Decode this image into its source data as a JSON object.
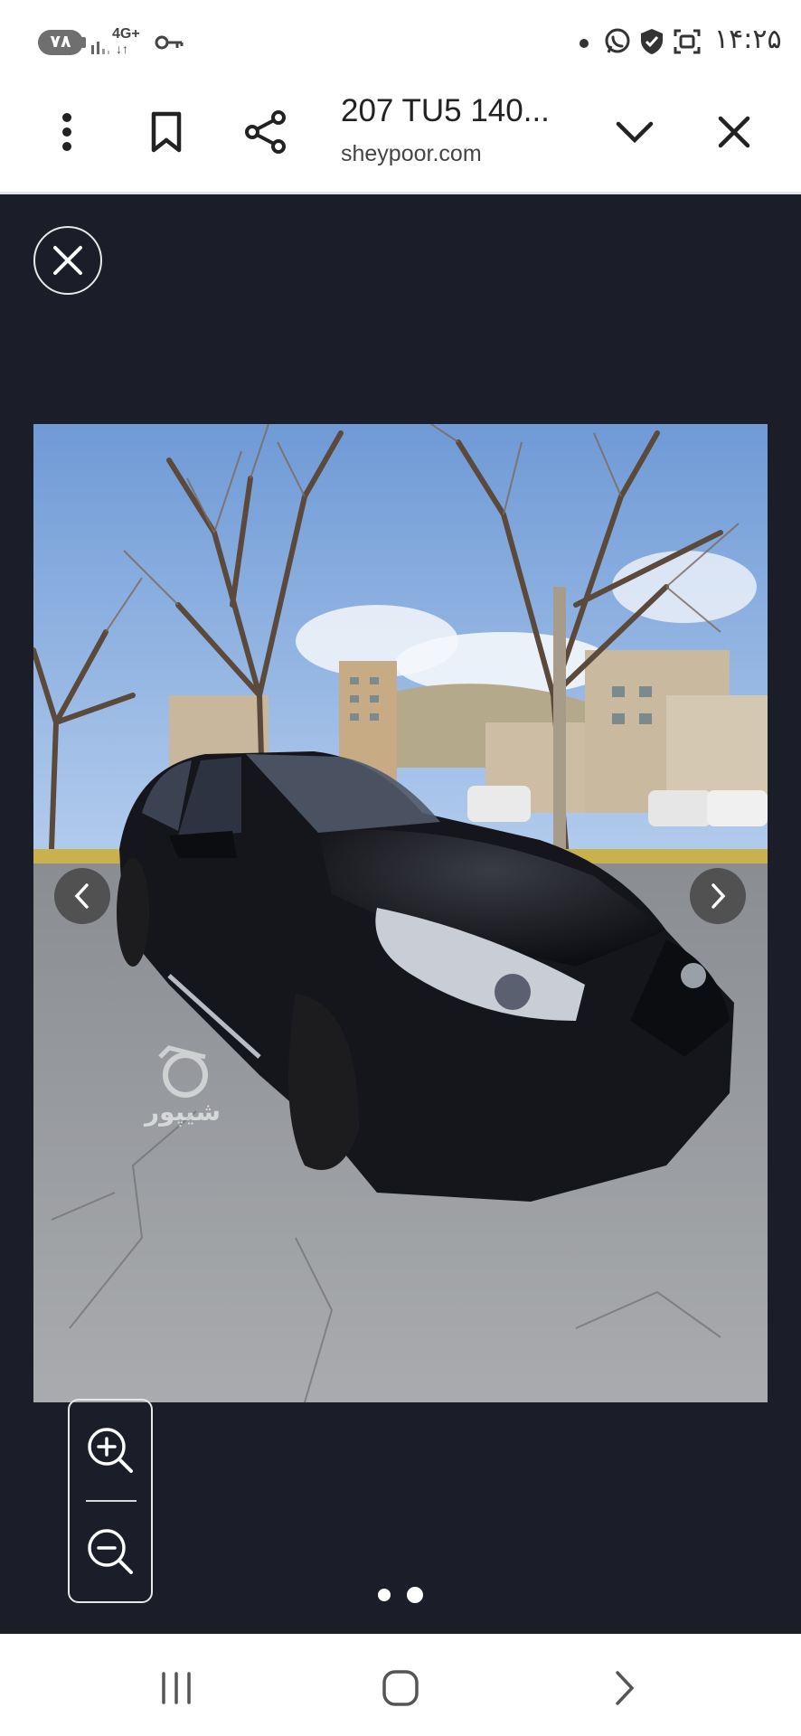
{
  "status_bar": {
    "battery": "۷۸",
    "network": "4G+",
    "network_arrows": "↓↑",
    "time": "۱۴:۲۵",
    "icons": [
      "signal-icon",
      "vpn-key-icon",
      "notification-dot-icon",
      "whatsapp-icon",
      "shield-check-icon",
      "screenshot-icon"
    ]
  },
  "browser": {
    "title": "207 TU5 140...",
    "url": "sheypoor.com",
    "menu_icon": "more-vertical-icon",
    "bookmark_icon": "bookmark-icon",
    "share_icon": "share-icon",
    "expand_icon": "chevron-down-icon",
    "close_icon": "close-icon"
  },
  "viewer": {
    "close_icon": "close-icon",
    "image_alt": "Black Peugeot 207 hatchback parked on a street with bare trees",
    "watermark": "شیپور",
    "prev_icon": "chevron-left-icon",
    "next_icon": "chevron-right-icon",
    "zoom_in_icon": "zoom-in-icon",
    "zoom_out_icon": "zoom-out-icon",
    "page_count": 2,
    "active_page": 2
  },
  "nav_bar": {
    "icons": [
      "recents-icon",
      "home-icon",
      "back-icon"
    ]
  },
  "colors": {
    "viewer_bg": "#1b1e29",
    "car_body": "#15161b",
    "sky": "#8fb4e6"
  }
}
